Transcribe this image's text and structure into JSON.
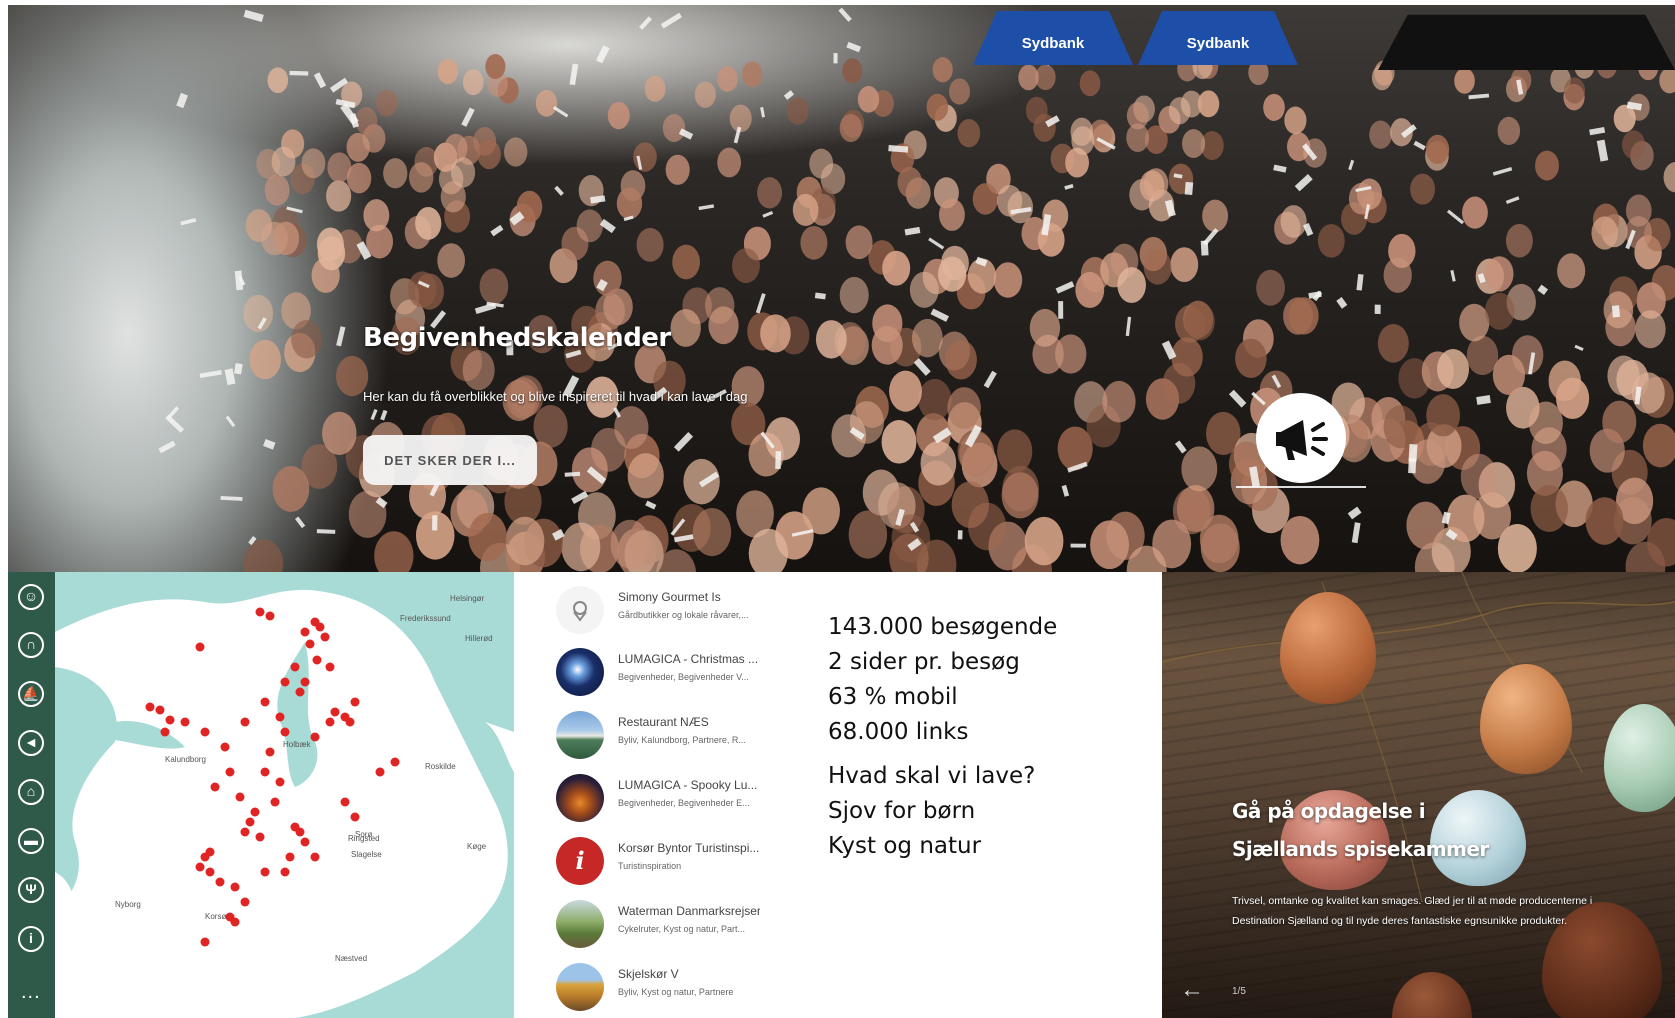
{
  "hero": {
    "title": "Begivenhedskalender",
    "subtitle": "Her kan du få overblikket og blive inspireret til hvad i kan lave i dag",
    "button_label": "DET SKER DER I...",
    "tent_labels": [
      "Sydbank",
      "Sydbank"
    ],
    "icon": "megaphone-icon"
  },
  "map": {
    "rail_icons": [
      "child-icon",
      "headphones-icon",
      "ship-icon",
      "megaphone-icon",
      "museum-icon",
      "bed-icon",
      "restaurant-icon",
      "info-icon"
    ],
    "more_label": "...",
    "labels": [
      "Frederikssund",
      "Roskilde",
      "Holbæk",
      "Kalundborg",
      "Sorø",
      "Ringsted",
      "Slagelse",
      "Næstved",
      "Korsør",
      "Nyborg",
      "Helsingør",
      "Hillerød",
      "Køge"
    ],
    "pin_color": "#e02424",
    "water_color": "#a9dbd6",
    "land_color": "#ffffff"
  },
  "list": {
    "items": [
      {
        "title": "Simony Gourmet Is",
        "subtitle": "Gårdbutikker og lokale råvarer,...",
        "thumb": "pin-icon"
      },
      {
        "title": "LUMAGICA - Christmas ...",
        "subtitle": "Begivenheder, Begivenheder V...",
        "thumb": "photo-night"
      },
      {
        "title": "Restaurant NÆS",
        "subtitle": "Byliv, Kalundborg, Partnere, R...",
        "thumb": "photo-restaurant"
      },
      {
        "title": "LUMAGICA - Spooky Lu...",
        "subtitle": "Begivenheder, Begivenheder E...",
        "thumb": "photo-spooky"
      },
      {
        "title": "Korsør Byntor Turistinspi...",
        "subtitle": "Turistinspiration",
        "thumb": "info-icon"
      },
      {
        "title": "Waterman Danmarksrejser",
        "subtitle": "Cykelruter, Kyst og natur, Part...",
        "thumb": "photo-bikes"
      },
      {
        "title": "Skjelskør V",
        "subtitle": "Byliv, Kyst og natur, Partnere",
        "thumb": "photo-town"
      }
    ]
  },
  "stats": {
    "lines": [
      "143.000 besøgende",
      "2 sider pr. besøg",
      "63 % mobil",
      "68.000 links"
    ],
    "topics": [
      "Hvad skal vi lave?",
      "Sjov for børn",
      "Kyst og natur"
    ]
  },
  "eggs": {
    "title": "Gå på opdagelse i Sjællands spisekammer",
    "text": "Trivsel, omtanke og kvalitet kan smages. Glæd jer til at møde producenterne i Destination Sjælland og til nyde deres fantastiske egnsunikke produkter.",
    "arrow": "←",
    "pager": "1/5"
  }
}
